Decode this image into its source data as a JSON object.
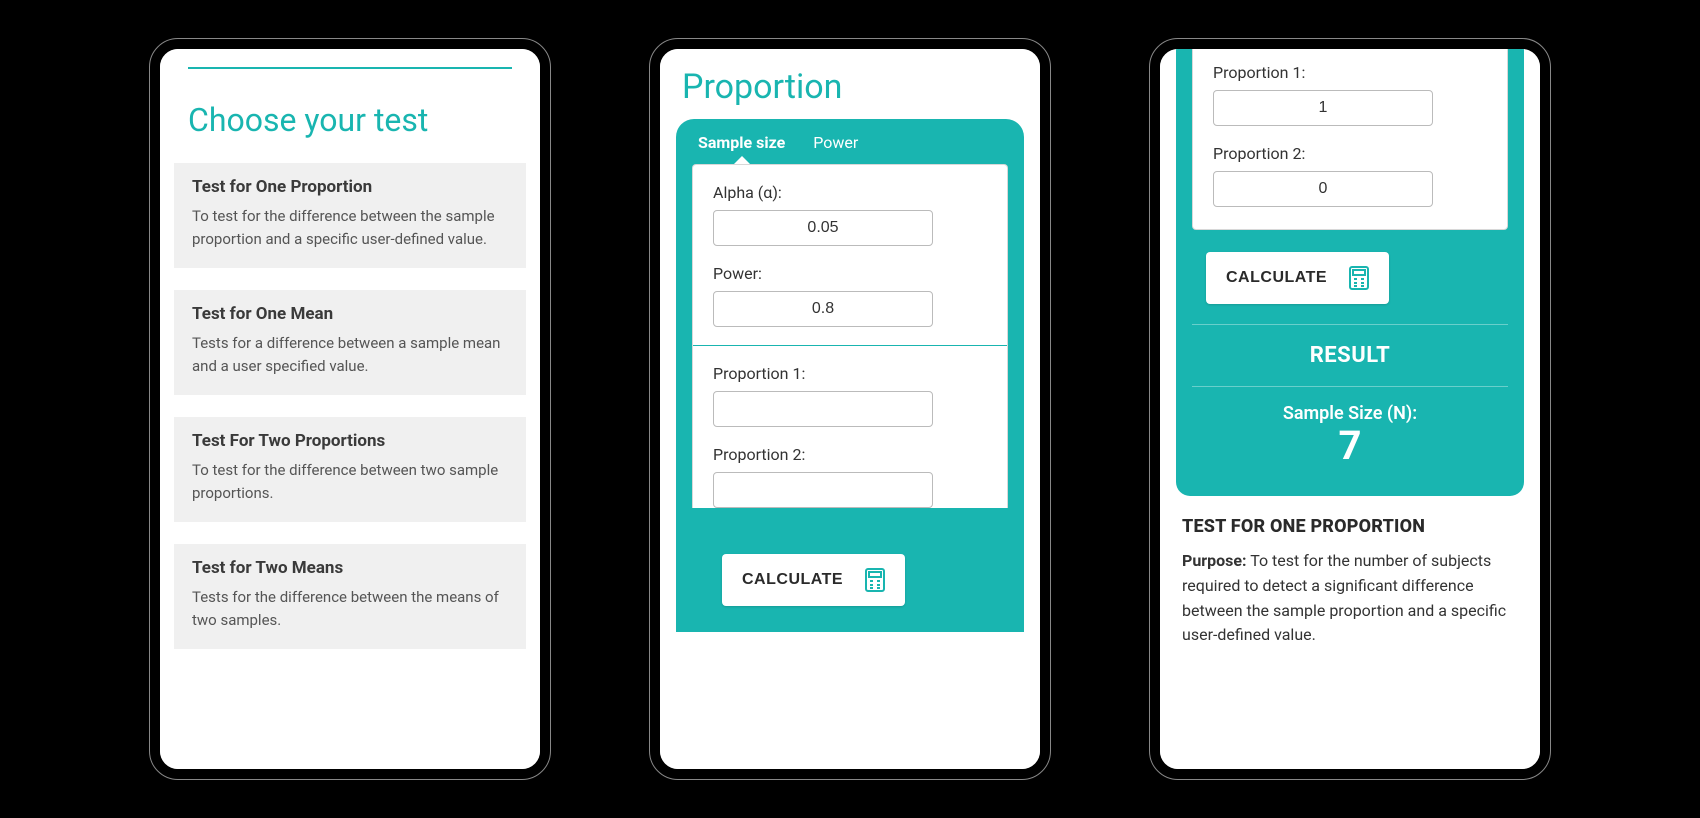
{
  "phone1": {
    "title": "Choose your test",
    "tests": [
      {
        "title": "Test for One Proportion",
        "desc": "To test for the difference between the sample proportion and a specific user-defined value."
      },
      {
        "title": "Test for One Mean",
        "desc": "Tests for a difference between a sample mean and a user specified value."
      },
      {
        "title": "Test For Two Proportions",
        "desc": "To test for the difference between two sample proportions."
      },
      {
        "title": "Test for Two Means",
        "desc": "Tests for the difference between the means of two samples."
      }
    ]
  },
  "phone2": {
    "title": "Proportion",
    "tabs": {
      "sample_size": "Sample size",
      "power": "Power"
    },
    "fields": {
      "alpha_label": "Alpha (α):",
      "alpha_value": "0.05",
      "power_label": "Power:",
      "power_value": "0.8",
      "prop1_label": "Proportion 1:",
      "prop1_value": "",
      "prop2_label": "Proportion 2:",
      "prop2_value": ""
    },
    "calc_label": "CALCULATE"
  },
  "phone3": {
    "fields": {
      "prop1_label": "Proportion 1:",
      "prop1_value": "1",
      "prop2_label": "Proportion 2:",
      "prop2_value": "0"
    },
    "calc_label": "CALCULATE",
    "result_header": "RESULT",
    "result_label": "Sample Size (N):",
    "result_value": "7",
    "info_title": "TEST FOR ONE PROPORTION",
    "info_purpose_label": "Purpose:",
    "info_purpose_text": " To test for the number of subjects required to detect a significant difference between the sample proportion and a specific user-defined value."
  }
}
